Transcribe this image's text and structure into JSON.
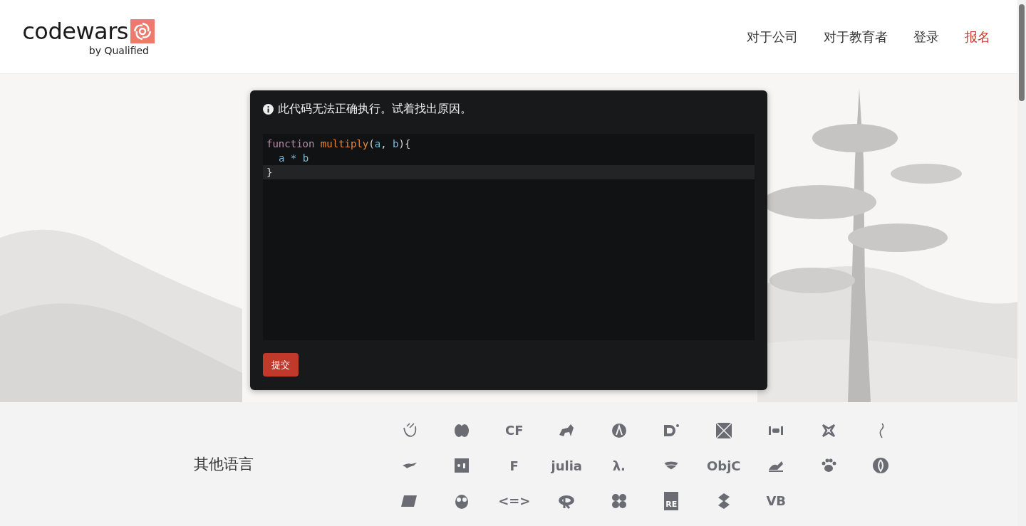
{
  "header": {
    "logo": {
      "name": "codewars",
      "tagline": "by Qualified"
    },
    "nav": [
      {
        "label": "对于公司",
        "kind": "link"
      },
      {
        "label": "对于教育者",
        "kind": "link"
      },
      {
        "label": "登录",
        "kind": "link"
      },
      {
        "label": "报名",
        "kind": "accent"
      }
    ]
  },
  "challenge": {
    "notice": "此代码无法正确执行。试着找出原因。",
    "code_lines": [
      {
        "active": false,
        "tokens": [
          {
            "kind": "keyword",
            "text": "function "
          },
          {
            "kind": "name",
            "text": "multiply"
          },
          {
            "kind": "punct",
            "text": "("
          },
          {
            "kind": "param",
            "text": "a"
          },
          {
            "kind": "punct",
            "text": ", "
          },
          {
            "kind": "param",
            "text": "b"
          },
          {
            "kind": "punct",
            "text": "){"
          }
        ]
      },
      {
        "active": false,
        "indent": true,
        "tokens": [
          {
            "kind": "param",
            "text": "a * b"
          }
        ]
      },
      {
        "active": true,
        "tokens": [
          {
            "kind": "punct",
            "text": "}"
          }
        ]
      }
    ],
    "submit": "提交"
  },
  "other_languages": {
    "label": "其他语言",
    "items": [
      {
        "kind": "icon"
      },
      {
        "kind": "icon"
      },
      {
        "kind": "text",
        "label": "CF"
      },
      {
        "kind": "icon"
      },
      {
        "kind": "icon"
      },
      {
        "kind": "icon"
      },
      {
        "kind": "icon"
      },
      {
        "kind": "icon"
      },
      {
        "kind": "icon"
      },
      {
        "kind": "icon"
      },
      {
        "kind": "icon"
      },
      {
        "kind": "icon"
      },
      {
        "kind": "text",
        "label": "F"
      },
      {
        "kind": "text",
        "label": "julia"
      },
      {
        "kind": "text",
        "label": "λ."
      },
      {
        "kind": "icon"
      },
      {
        "kind": "text",
        "label": "ObjC"
      },
      {
        "kind": "icon"
      },
      {
        "kind": "icon"
      },
      {
        "kind": "icon"
      },
      {
        "kind": "icon"
      },
      {
        "kind": "icon"
      },
      {
        "kind": "text",
        "label": "<=>"
      },
      {
        "kind": "icon"
      },
      {
        "kind": "icon"
      },
      {
        "kind": "boxed",
        "label": "RE"
      },
      {
        "kind": "icon"
      },
      {
        "kind": "text",
        "label": "VB"
      }
    ]
  }
}
